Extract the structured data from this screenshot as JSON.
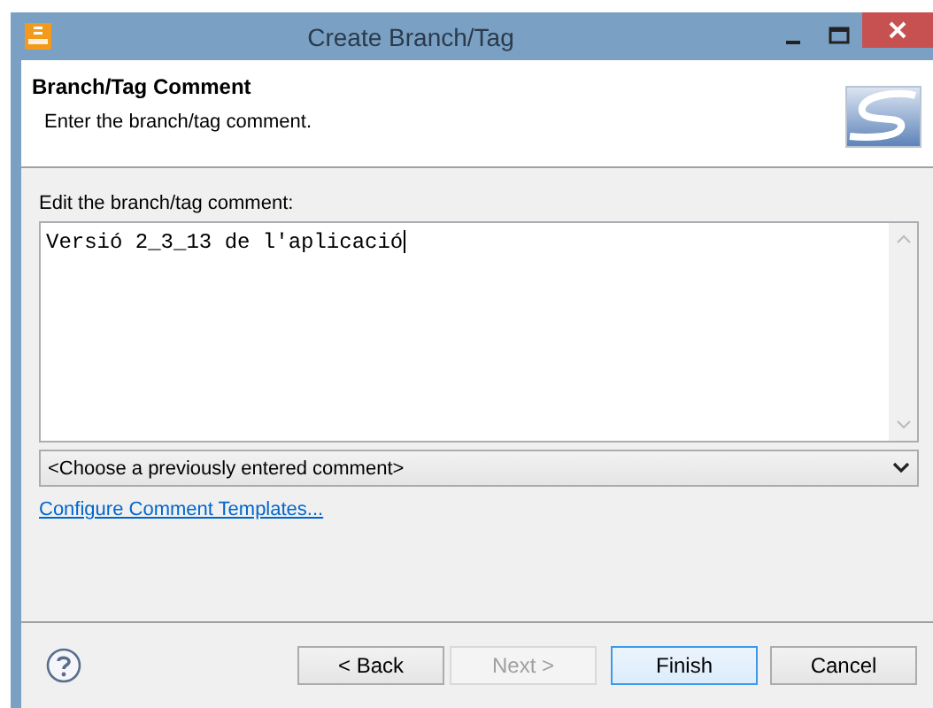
{
  "window": {
    "title": "Create Branch/Tag"
  },
  "header": {
    "title": "Branch/Tag Comment",
    "description": "Enter the branch/tag comment."
  },
  "comment": {
    "label": "Edit the branch/tag comment:",
    "value": "Versió 2_3_13 de l'aplicació"
  },
  "previous_comments": {
    "value": "<Choose a previously entered comment>"
  },
  "link": "Configure Comment Templates...",
  "buttons": [
    {
      "label": "< Back",
      "disabled": false,
      "default": false
    },
    {
      "label": "Next >",
      "disabled": true,
      "default": false
    },
    {
      "label": "Finish",
      "disabled": false,
      "default": true
    },
    {
      "label": "Cancel",
      "disabled": false,
      "default": false
    }
  ]
}
